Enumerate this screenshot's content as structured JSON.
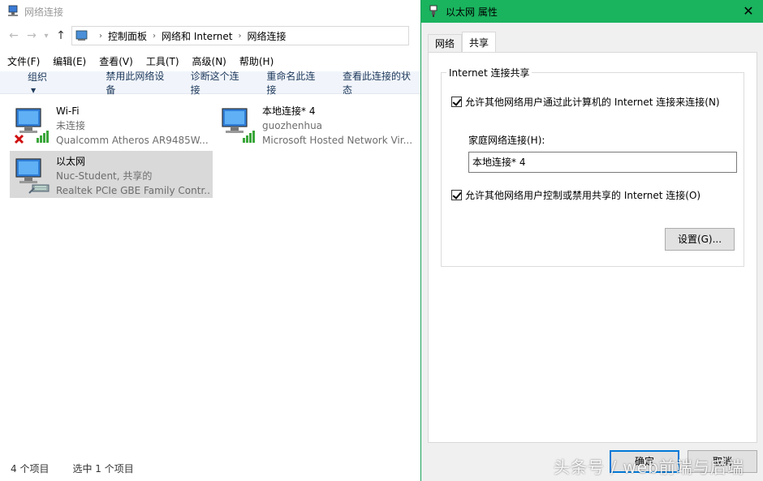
{
  "explorer": {
    "title": "网络连接",
    "nav": {
      "back": "←",
      "forward": "→",
      "recent": "▾",
      "up": "↑"
    },
    "breadcrumb": [
      "控制面板",
      "网络和 Internet",
      "网络连接"
    ],
    "menu": [
      "文件(F)",
      "编辑(E)",
      "查看(V)",
      "工具(T)",
      "高级(N)",
      "帮助(H)"
    ],
    "commands": {
      "organize": "组织",
      "disable": "禁用此网络设备",
      "diagnose": "诊断这个连接",
      "rename": "重命名此连接",
      "status": "查看此连接的状态"
    },
    "connections": [
      {
        "name": "Wi-Fi",
        "status": "未连接",
        "device": "Qualcomm Atheros AR9485W...",
        "icon": "wifi-disconnected-icon"
      },
      {
        "name": "本地连接* 4",
        "status": "guozhenhua",
        "device": "Microsoft Hosted Network Vir...",
        "icon": "wifi-signal-icon"
      },
      {
        "name": "以太网",
        "status": "Nuc-Student, 共享的",
        "device": "Realtek PCIe GBE Family Contr...",
        "icon": "ethernet-icon"
      }
    ],
    "status_bar": {
      "count": "4 个项目",
      "selected": "选中 1 个项目"
    }
  },
  "dialog": {
    "title": "以太网 属性",
    "close": "✕",
    "tabs": [
      "网络",
      "共享"
    ],
    "active_tab": "共享",
    "group_title": "Internet 连接共享",
    "allow_connect_label": "允许其他网络用户通过此计算机的 Internet 连接来连接(N)",
    "allow_connect_checked": true,
    "home_network_label": "家庭网络连接(H):",
    "home_network_value": "本地连接* 4",
    "allow_control_label": "允许其他网络用户控制或禁用共享的 Internet 连接(O)",
    "allow_control_checked": true,
    "settings_button": "设置(G)...",
    "ok_button": "确定",
    "cancel_button": "取消"
  },
  "watermark": "头条号 / web前端与后端",
  "colors": {
    "dialog_titlebar": "#1ab35e",
    "focus": "#0078d7",
    "command_text": "#1e395b"
  }
}
